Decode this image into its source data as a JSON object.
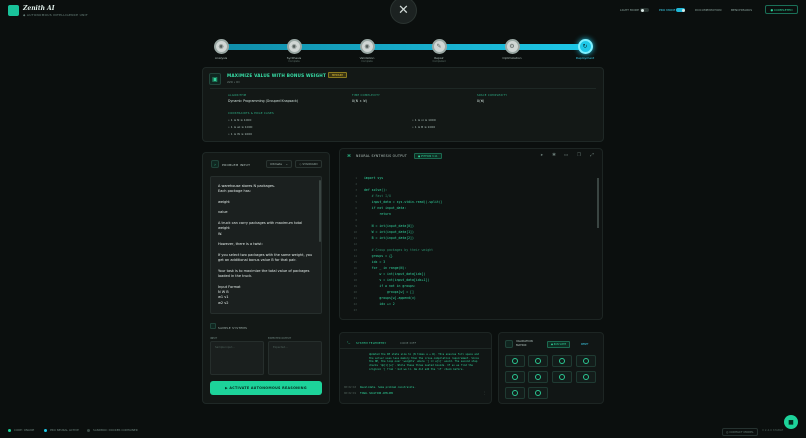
{
  "app": {
    "title": "Zenith AI",
    "subtitle": "◆ AUTONOMOUS INTELLIGENCE UNIT"
  },
  "topbar": {
    "light_mode_label": "LIGHT MODE",
    "pro_mode_label": "PRO MODE",
    "documentation_label": "DOCUMENTATION",
    "benchmarks_label": "BENCHMARKS",
    "completed_label": "● COMPLETED"
  },
  "close": {
    "glyph": "✕"
  },
  "pipeline": {
    "stages": [
      {
        "label": "Analysis",
        "sub": "",
        "glyph": "◉"
      },
      {
        "label": "Synthesis",
        "sub": "Complete",
        "glyph": "◉"
      },
      {
        "label": "Validation",
        "sub": "Complete",
        "glyph": "◉"
      },
      {
        "label": "Repair",
        "sub": "Completed",
        "glyph": "✎"
      },
      {
        "label": "Optimization",
        "sub": "",
        "glyph": "⚙"
      },
      {
        "label": "Deployment",
        "sub": "",
        "glyph": "↻"
      }
    ]
  },
  "problem": {
    "title": "MAXIMIZE VALUE WITH BONUS WEIGHT PAIRS",
    "badge": "MEDIUM",
    "id": "220 • ID",
    "algorithm_label": "ALGORITHM",
    "algorithm_value": "Dynamic Programming (Grouped Knapsack)",
    "time_label": "TIME COMPLEXITY",
    "time_value": "O(N × W)",
    "space_label": "SPACE COMPLEXITY",
    "space_value": "O(W)",
    "constraints_label": "CONSTRAINTS & EDGE CASES",
    "constraints": [
      "1 ≤ N ≤ 1000",
      "1 ≤ wi ≤ 1000",
      "1 ≤ W ≤ 1000",
      "1 ≤ vi ≤ 1000",
      "1 ≤ B ≤ 1000"
    ]
  },
  "input_panel": {
    "title": "PROBLEM INPUT",
    "select_value": "Ultimate",
    "standard_label": "◇ STANDARD",
    "text_lines": [
      "A warehouse stores N packages.",
      "Each package has:",
      "",
      "weight",
      "",
      "value",
      "",
      "A truck can carry packages with maximum total weight",
      "W.",
      "",
      "However, there is a twist:",
      "",
      "If you select two packages with the same weight, you",
      "get an additional bonus value B for that pair.",
      "",
      "Your task is to maximize the total value of packages",
      "loaded in the truck.",
      "",
      "Input Format",
      "N W B",
      "w1 v1",
      "w2 v2"
    ],
    "samples_title": "SAMPLE SYSTEMS",
    "input_label": "INPUT",
    "output_label": "EXPECTED OUTPUT",
    "input_placeholder": "Sample input...",
    "output_placeholder": "Expected...",
    "activate_label": "▶ ACTIVATE AUTONOMOUS REASONING"
  },
  "code_panel": {
    "title": "NEURAL SYNTHESIS OUTPUT",
    "badge": "● PYTHON 3.11",
    "lines": [
      {
        "n": "1",
        "t": "import sys",
        "c": false
      },
      {
        "n": "2",
        "t": "",
        "c": false
      },
      {
        "n": "3",
        "t": "def solve():",
        "c": false
      },
      {
        "n": "4",
        "t": "    # Fast I/O",
        "c": true
      },
      {
        "n": "5",
        "t": "    input_data = sys.stdin.read().split()",
        "c": false
      },
      {
        "n": "6",
        "t": "    if not input_data:",
        "c": false
      },
      {
        "n": "7",
        "t": "        return",
        "c": false
      },
      {
        "n": "8",
        "t": "",
        "c": false
      },
      {
        "n": "9",
        "t": "    N = int(input_data[0])",
        "c": false
      },
      {
        "n": "10",
        "t": "    W = int(input_data[1])",
        "c": false
      },
      {
        "n": "11",
        "t": "    B = int(input_data[2])",
        "c": false
      },
      {
        "n": "12",
        "t": "",
        "c": false
      },
      {
        "n": "13",
        "t": "    # Group packages by their weight",
        "c": true
      },
      {
        "n": "14",
        "t": "    groups = {}",
        "c": false
      },
      {
        "n": "15",
        "t": "    idx = 3",
        "c": false
      },
      {
        "n": "16",
        "t": "    for _ in range(N):",
        "c": false
      },
      {
        "n": "17",
        "t": "        w = int(input_data[idx])",
        "c": false
      },
      {
        "n": "18",
        "t": "        v = int(input_data[idx+1])",
        "c": false
      },
      {
        "n": "19",
        "t": "        if w not in groups:",
        "c": false
      },
      {
        "n": "20",
        "t": "            groups[w] = []",
        "c": false
      },
      {
        "n": "21",
        "t": "        groups[w].append(v)",
        "c": false
      },
      {
        "n": "22",
        "t": "        idx += 2",
        "c": false
      },
      {
        "n": "23",
        "t": "",
        "c": false
      }
    ]
  },
  "telemetry": {
    "tab_active": "SYSTEM TELEMETRY",
    "tab_other": "CODE DIFF",
    "text": "Updated the DP state size to (N times a + W). This ensures full space and the solver uses less memory than the cross-compilation requirement. Since the NP, the loop over 'weights' where 'j >= w[i]' would. The second step checks 'dp[i][w]'. While these three nested bounds. If so we find the original '[ from ' but we ll. We did add the 'if' check before.",
    "rows": [
      {
        "time": "00:02:18",
        "msg": "Revalidate. Some problem constraints."
      },
      {
        "time": "00:02:19",
        "msg": "FINAL SOLUTION APPLIED"
      }
    ]
  },
  "validation": {
    "title": "VALIDATION MATRIX",
    "btn_run": "● RUN SUITE",
    "btn_reset": "RESET"
  },
  "bottom": {
    "core_label": "CORE: ONLINE",
    "pro_label": "PRO NEURAL ACTIVE",
    "sandbox_label": "SANDBOX: DOCKER CONTAINER",
    "support_label": "◎ CONTACT MODEL",
    "version_label": "V 2.4.0 STABLE"
  },
  "colors": {
    "accent": "#1dd39a",
    "pipeline": "#1ec8e8",
    "badge": "#e6c53a"
  }
}
